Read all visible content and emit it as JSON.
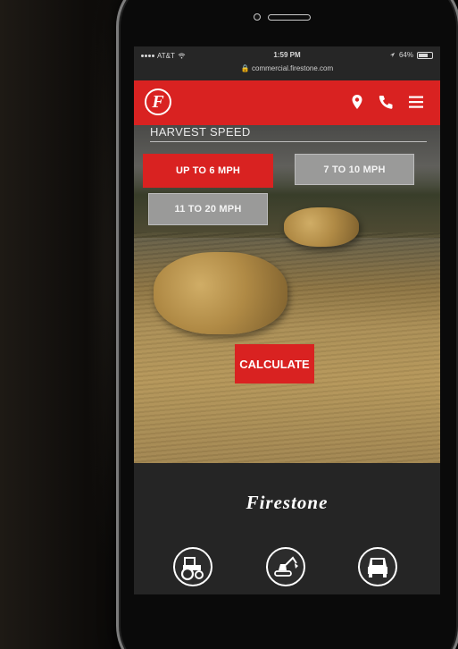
{
  "status_bar": {
    "carrier": "AT&T",
    "time": "1:59 PM",
    "battery": "64%",
    "url": "commercial.firestone.com"
  },
  "nav": {
    "logo_letter": "F",
    "icons": [
      "location-pin-icon",
      "phone-icon",
      "menu-icon"
    ]
  },
  "harvest": {
    "title": "HARVEST SPEED",
    "options": [
      {
        "label": "UP TO 6 MPH",
        "selected": true
      },
      {
        "label": "7 TO 10 MPH",
        "selected": false
      },
      {
        "label": "11 TO 20 MPH",
        "selected": false
      }
    ],
    "calculate_label": "CALCULATE"
  },
  "footer": {
    "brand": "Firestone",
    "icons": [
      "tractor-icon",
      "excavator-icon",
      "truck-icon"
    ]
  },
  "colors": {
    "brand_red": "#d92221",
    "inactive_gray": "#9a9a99",
    "footer_bg": "#252525"
  }
}
